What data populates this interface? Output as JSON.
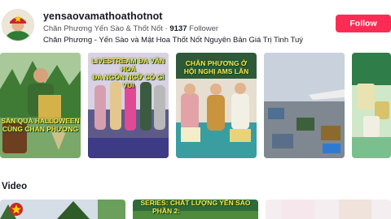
{
  "profile": {
    "username": "yensaovamathoathotnot",
    "display_name": "Chăn Phương Yến Sào & Thốt Nốt",
    "separator": "·",
    "followers_count": "9137",
    "followers_label": "Follower",
    "bio": "Chăn Phương - Yến Sào và Mật Hoa Thốt Nốt Nguyên Bản Giá Trị Tinh Tuý",
    "follow_label": "Follow"
  },
  "posts": [
    {
      "caption_line1": "SĂN QUÀ HALLOWEEN",
      "caption_line2": "CÙNG CHĂN PHƯƠNG"
    },
    {
      "caption_line1": "LIVESTREAM ĐA VĂN HOÁ",
      "caption_line2": "ĐA NGÔN NGỮ CÓ GÌ VUI"
    },
    {
      "caption_line1": "CHĂN PHƯƠNG Ở",
      "caption_line2": "HỘI NGHỊ AMS LẦN"
    },
    {
      "caption_line1": "",
      "caption_line2": ""
    },
    {
      "caption_line1": "",
      "caption_line2": ""
    }
  ],
  "videos_section": {
    "title": "Video",
    "items": [
      {
        "caption": ""
      },
      {
        "caption_line1": "SERIES: CHẤT LƯỢNG YẾN SÀO",
        "caption_line2": "PHẦN 2:"
      },
      {
        "caption": ""
      }
    ]
  },
  "colors": {
    "accent": "#fe2c55",
    "caption_yellow": "#ffe14a",
    "text_primary": "#161823",
    "text_secondary": "#505059"
  }
}
